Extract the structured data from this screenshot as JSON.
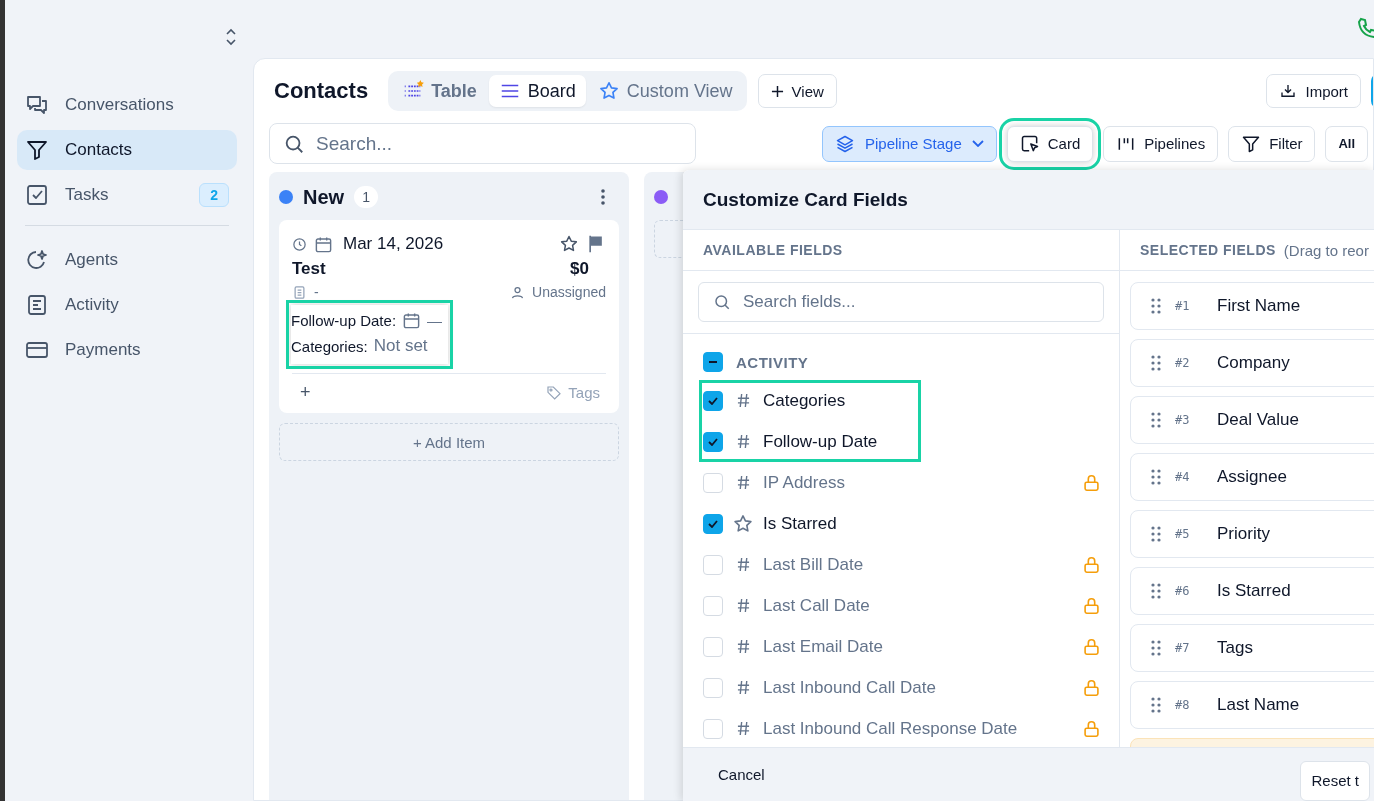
{
  "sidebar": {
    "sections": [
      {
        "items": [
          {
            "label": "Conversations",
            "selected": false
          },
          {
            "label": "Contacts",
            "selected": true
          },
          {
            "label": "Tasks",
            "selected": false,
            "badge": "2"
          }
        ]
      },
      {
        "items": [
          {
            "label": "Agents",
            "selected": false
          },
          {
            "label": "Activity",
            "selected": false
          },
          {
            "label": "Payments",
            "selected": false
          }
        ]
      }
    ]
  },
  "header": {
    "title": "Contacts",
    "view_tabs": [
      {
        "label": "Table",
        "selected": false,
        "starred": true
      },
      {
        "label": "Board",
        "selected": true,
        "starred": false
      },
      {
        "label": "Custom View",
        "selected": false,
        "starred": false
      }
    ],
    "add_view": "View",
    "import": "Import"
  },
  "toolbar": {
    "search": {
      "placeholder": "Search..."
    },
    "buttons": [
      {
        "kind": "dropdown",
        "label": "Pipeline Stage",
        "highlighted": false
      },
      {
        "kind": "plain",
        "label": "Card",
        "highlighted": true
      },
      {
        "kind": "plain",
        "label": "Pipelines",
        "highlighted": false
      },
      {
        "kind": "plain",
        "label": "Filter",
        "highlighted": false
      },
      {
        "kind": "text",
        "label": "All",
        "highlighted": false
      }
    ]
  },
  "columns": [
    {
      "name": "New",
      "count": "1",
      "color": "#3b82f6",
      "add_item": "+ Add Item",
      "cards": [
        {
          "date": "Mar 14, 2026",
          "title": "Test",
          "amount": "$0",
          "company": "-",
          "assignee": "Unassigned",
          "starred": false,
          "highlighted": true,
          "fields": [
            {
              "kind": "date",
              "label": "Follow-up Date:",
              "value": "—"
            },
            {
              "kind": "text",
              "label": "Categories:",
              "value": "Not set"
            }
          ],
          "add": "+",
          "tags": "Tags"
        }
      ]
    },
    {
      "color": "#8b5cf6"
    }
  ],
  "modal": {
    "title": "Customize Card Fields",
    "available_heading": "AVAILABLE FIELDS",
    "selected_heading": "SELECTED FIELDS",
    "selected_hint": "(Drag to reor",
    "search": {
      "placeholder": "Search fields..."
    },
    "group": {
      "name": "ACTIVITY",
      "indeterminate": true,
      "fields": [
        {
          "kind": "number",
          "label": "Categories",
          "checked": true,
          "locked": false,
          "highlighted": true
        },
        {
          "kind": "number",
          "label": "Follow-up Date",
          "checked": true,
          "locked": false,
          "highlighted": true
        },
        {
          "kind": "number",
          "label": "IP Address",
          "checked": false,
          "locked": true,
          "highlighted": false
        },
        {
          "kind": "boolean",
          "label": "Is Starred",
          "checked": true,
          "locked": false,
          "highlighted": false
        },
        {
          "kind": "number",
          "label": "Last Bill Date",
          "checked": false,
          "locked": true,
          "highlighted": false
        },
        {
          "kind": "number",
          "label": "Last Call Date",
          "checked": false,
          "locked": true,
          "highlighted": false
        },
        {
          "kind": "number",
          "label": "Last Email Date",
          "checked": false,
          "locked": true,
          "highlighted": false
        },
        {
          "kind": "number",
          "label": "Last Inbound Call Date",
          "checked": false,
          "locked": true,
          "highlighted": false
        },
        {
          "kind": "number",
          "label": "Last Inbound Call Response Date",
          "checked": false,
          "locked": true,
          "highlighted": false
        }
      ]
    },
    "selected": [
      {
        "number": "#1",
        "label": "First Name"
      },
      {
        "number": "#2",
        "label": "Company"
      },
      {
        "number": "#3",
        "label": "Deal Value"
      },
      {
        "number": "#4",
        "label": "Assignee"
      },
      {
        "number": "#5",
        "label": "Priority"
      },
      {
        "number": "#6",
        "label": "Is Starred"
      },
      {
        "number": "#7",
        "label": "Tags"
      },
      {
        "number": "#8",
        "label": "Last Name"
      }
    ],
    "cancel": "Cancel",
    "reset": "Reset t"
  }
}
